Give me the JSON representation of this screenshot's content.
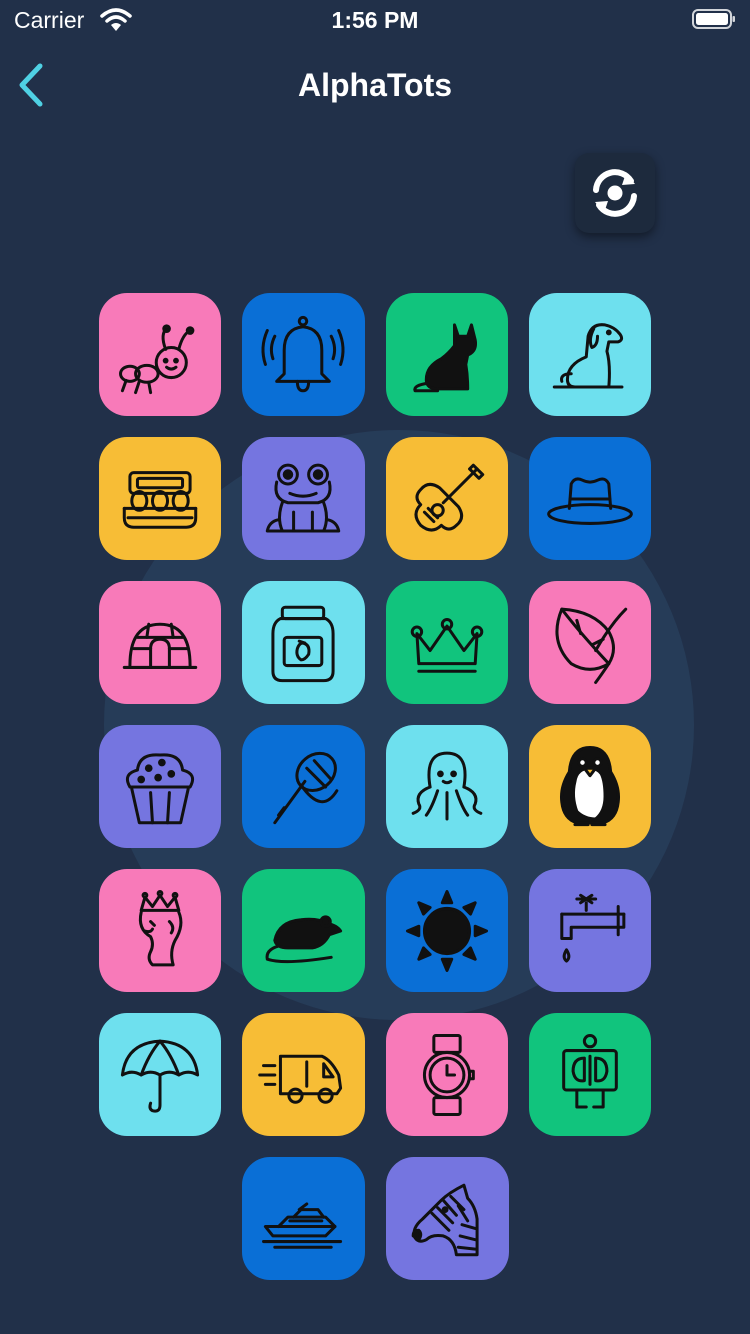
{
  "status_bar": {
    "carrier": "Carrier",
    "time": "1:56 PM"
  },
  "nav": {
    "title": "AlphaTots",
    "back_icon": "chevron-left-icon"
  },
  "refresh_button": {
    "icon": "refresh-icon"
  },
  "colors": {
    "background": "#213049",
    "pink": "#f87ab9",
    "blue": "#0a6fd6",
    "green": "#11c47d",
    "cyan": "#6ee0ee",
    "yellow": "#f7bd36",
    "purple": "#7575e0",
    "accent": "#4fd1e4"
  },
  "tiles": [
    {
      "name": "ant",
      "color": "pink"
    },
    {
      "name": "bell",
      "color": "blue"
    },
    {
      "name": "cat",
      "color": "green"
    },
    {
      "name": "dog",
      "color": "cyan"
    },
    {
      "name": "eggs",
      "color": "yellow"
    },
    {
      "name": "frog",
      "color": "purple"
    },
    {
      "name": "guitar",
      "color": "yellow"
    },
    {
      "name": "hat",
      "color": "blue"
    },
    {
      "name": "igloo",
      "color": "pink"
    },
    {
      "name": "jam",
      "color": "cyan"
    },
    {
      "name": "king",
      "color": "green"
    },
    {
      "name": "leaf",
      "color": "pink"
    },
    {
      "name": "muffin",
      "color": "purple"
    },
    {
      "name": "net",
      "color": "blue"
    },
    {
      "name": "octopus",
      "color": "cyan"
    },
    {
      "name": "penguin",
      "color": "yellow"
    },
    {
      "name": "queen",
      "color": "pink"
    },
    {
      "name": "rat",
      "color": "green"
    },
    {
      "name": "sun",
      "color": "blue"
    },
    {
      "name": "tap",
      "color": "purple"
    },
    {
      "name": "umbrella",
      "color": "cyan"
    },
    {
      "name": "van",
      "color": "yellow"
    },
    {
      "name": "watch",
      "color": "pink"
    },
    {
      "name": "x-ray",
      "color": "green"
    },
    {
      "name": "yacht",
      "color": "blue"
    },
    {
      "name": "zebra",
      "color": "purple"
    }
  ]
}
